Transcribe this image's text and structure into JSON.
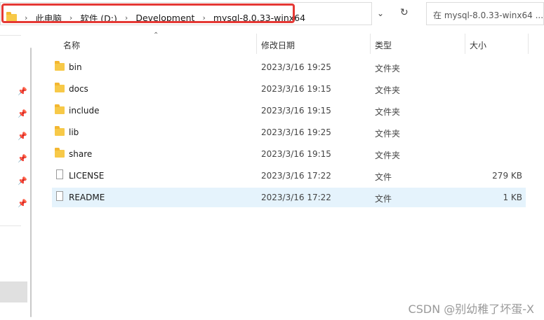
{
  "address_bar": {
    "breadcrumbs": [
      "此电脑",
      "软件 (D:)",
      "Development",
      "mysql-8.0.33-winx64"
    ],
    "separator": "›"
  },
  "search": {
    "placeholder": "在 mysql-8.0.33-winx64 ..."
  },
  "columns": {
    "name": "名称",
    "date": "修改日期",
    "type": "类型",
    "size": "大小"
  },
  "files": [
    {
      "name": "bin",
      "date": "2023/3/16 19:25",
      "type": "文件夹",
      "size": "",
      "icon": "folder-icon"
    },
    {
      "name": "docs",
      "date": "2023/3/16 19:15",
      "type": "文件夹",
      "size": "",
      "icon": "folder-icon"
    },
    {
      "name": "include",
      "date": "2023/3/16 19:15",
      "type": "文件夹",
      "size": "",
      "icon": "folder-icon"
    },
    {
      "name": "lib",
      "date": "2023/3/16 19:25",
      "type": "文件夹",
      "size": "",
      "icon": "folder-icon"
    },
    {
      "name": "share",
      "date": "2023/3/16 19:15",
      "type": "文件夹",
      "size": "",
      "icon": "folder-icon"
    },
    {
      "name": "LICENSE",
      "date": "2023/3/16 17:22",
      "type": "文件",
      "size": "279 KB",
      "icon": "file-icon"
    },
    {
      "name": "README",
      "date": "2023/3/16 17:22",
      "type": "文件",
      "size": "1 KB",
      "icon": "file-icon",
      "selected": true
    }
  ],
  "watermark": "CSDN @别幼稚了坏蛋-X",
  "colors": {
    "highlight_border": "#e53935",
    "selected_row": "#e5f3fc",
    "folder": "#f7c948"
  }
}
